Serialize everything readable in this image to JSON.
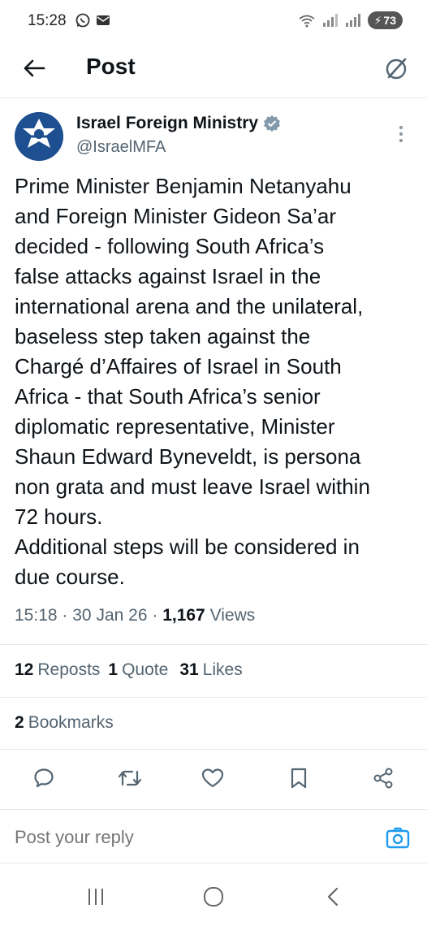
{
  "status_bar": {
    "time": "15:28",
    "battery": "73",
    "icons": [
      "whatsapp-icon",
      "mail-icon",
      "wifi-icon",
      "signal-icon",
      "battery-icon"
    ]
  },
  "header": {
    "title": "Post",
    "back_icon": "arrow-left-icon",
    "grok_icon": "grok-icon"
  },
  "author": {
    "name": "Israel Foreign Ministry",
    "handle": "@IsraelMFA",
    "verified": true
  },
  "post": {
    "text": "Prime Minister Benjamin Netanyahu\nand Foreign Minister Gideon Sa’ar\ndecided - following South Africa’s\nfalse attacks against Israel in the\ninternational arena and the unilateral,\nbaseless step taken against the\nChargé d’Affaires of Israel in South\nAfrica - that South Africa’s senior\ndiplomatic representative, Minister\nShaun Edward Byneveldt, is persona\nnon grata and must leave Israel within\n72 hours.\nAdditional steps will be considered in\ndue course.",
    "time": "15:18",
    "date": "30 Jan 26",
    "views_count": "1,167",
    "views_label": "Views",
    "separator": "·"
  },
  "stats": {
    "reposts_count": "12",
    "reposts_label": "Reposts",
    "quote_count": "1",
    "quote_label": "Quote",
    "likes_count": "31",
    "likes_label": "Likes",
    "bookmarks_count": "2",
    "bookmarks_label": "Bookmarks"
  },
  "actions": [
    "reply-icon",
    "repost-icon",
    "like-icon",
    "bookmark-icon",
    "share-icon"
  ],
  "reply": {
    "placeholder": "Post your reply"
  },
  "colors": {
    "accent": "#1d9bf0",
    "text": "#0f1419",
    "muted": "#536471",
    "avatar": "#1d4f91"
  }
}
